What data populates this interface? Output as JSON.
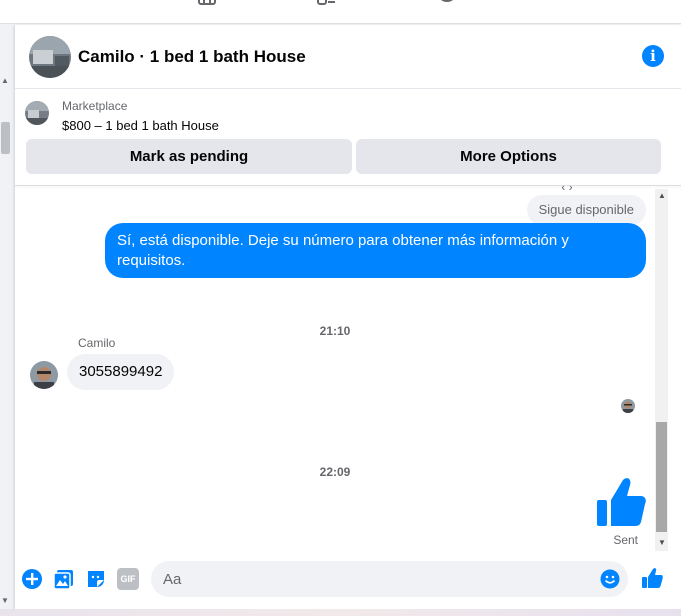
{
  "colors": {
    "accent": "#0084ff",
    "bubble_incoming": "#f0f2f5",
    "button_bg": "#e4e6eb",
    "secondary_text": "#65676b"
  },
  "top_nav": {
    "icons": [
      "marketplace-icon",
      "groups-icon",
      "profile-icon"
    ]
  },
  "header": {
    "title": "Camilo · 1 bed 1 bath House",
    "info_icon": "info-icon"
  },
  "listing": {
    "label": "Marketplace",
    "detail": "$800 – 1 bed 1 bath House"
  },
  "actions": {
    "mark_pending": "Mark as pending",
    "more_options": "More Options"
  },
  "messages": {
    "reply_quote": "Sigue disponible",
    "outgoing_text": "Sí, está disponible. Deje su número para obtener más información y requisitos.",
    "time_1": "21:10",
    "sender_name": "Camilo",
    "incoming_text": "3055899492",
    "time_2": "22:09",
    "sent_status": "Sent"
  },
  "composer": {
    "placeholder": "Aa",
    "icons": [
      "add-icon",
      "photo-icon",
      "sticker-icon",
      "gif-icon",
      "emoji-icon",
      "like-icon"
    ],
    "gif_label": "GIF"
  }
}
